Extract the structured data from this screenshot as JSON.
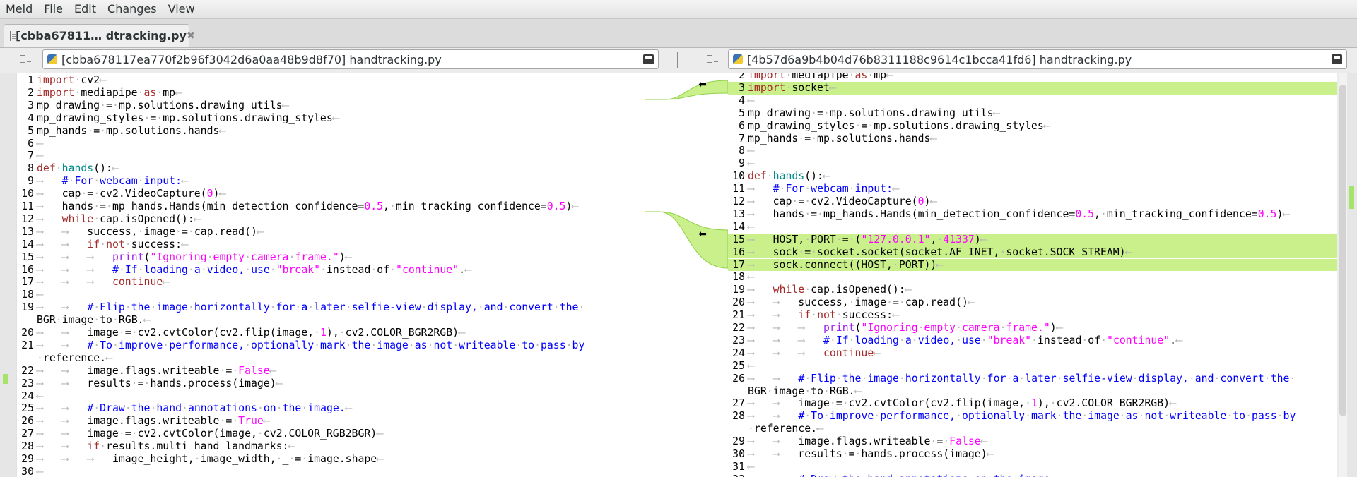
{
  "menu": [
    "Meld",
    "File",
    "Edit",
    "Changes",
    "View"
  ],
  "tab": {
    "label": "[cbba67811… dtracking.py",
    "close": "✖"
  },
  "left_file": {
    "path": "[cbba678117ea770f2b96f3042d6a0aa48b9d8f70] handtracking.py"
  },
  "right_file": {
    "path": "[4b57d6a9b4b04d76b8311188c9614c1bcca41fd6] handtracking.py"
  },
  "icons": {
    "doc": "document-icon",
    "python": "python-file-icon",
    "save": "save-icon",
    "options": "pane-options-icon",
    "arrow": "copy-left-arrow-icon",
    "close": "close-icon"
  },
  "colors": {
    "insert": "#c9f08a",
    "keyword": "#a52a2a",
    "string": "#ff00ff",
    "comment": "#0000ff"
  },
  "arrow_glyph": "⬅",
  "left_lines": [
    {
      "n": "1",
      "t": "import·cv2⟵"
    },
    {
      "n": "2",
      "t": "import·mediapipe·as·mp⟵"
    },
    {
      "n": "3",
      "t": "mp_drawing·=·mp.solutions.drawing_utils⟵"
    },
    {
      "n": "4",
      "t": "mp_drawing_styles·=·mp.solutions.drawing_styles⟵"
    },
    {
      "n": "5",
      "t": "mp_hands·=·mp.solutions.hands⟵"
    },
    {
      "n": "6",
      "t": "⟵"
    },
    {
      "n": "7",
      "t": "⟵"
    },
    {
      "n": "8",
      "t": "def·hands():⟵"
    },
    {
      "n": "9",
      "t": "⟶   #·For·webcam·input:⟵"
    },
    {
      "n": "10",
      "t": "⟶   cap·=·cv2.VideoCapture(0)⟵"
    },
    {
      "n": "11",
      "t": "⟶   hands·=·mp_hands.Hands(min_detection_confidence=0.5,·min_tracking_confidence=0.5)⟵"
    },
    {
      "n": "12",
      "t": "⟶   while·cap.isOpened():⟵"
    },
    {
      "n": "13",
      "t": "⟶   ⟶   success,·image·=·cap.read()⟵"
    },
    {
      "n": "14",
      "t": "⟶   ⟶   if·not·success:⟵"
    },
    {
      "n": "15",
      "t": "⟶   ⟶   ⟶   print(\"Ignoring·empty·camera·frame.\")⟵"
    },
    {
      "n": "16",
      "t": "⟶   ⟶   ⟶   #·If·loading·a·video,·use·\"break\"·instead·of·\"continue\".⟵"
    },
    {
      "n": "17",
      "t": "⟶   ⟶   ⟶   continue⟵"
    },
    {
      "n": "18",
      "t": "⟵"
    },
    {
      "n": "19",
      "t": "⟶   ⟶   #·Flip·the·image·horizontally·for·a·later·selfie-view·display,·and·convert·the·"
    },
    {
      "n": "",
      "t": "BGR·image·to·RGB.⟵"
    },
    {
      "n": "20",
      "t": "⟶   ⟶   image·=·cv2.cvtColor(cv2.flip(image,·1),·cv2.COLOR_BGR2RGB)⟵"
    },
    {
      "n": "21",
      "t": "⟶   ⟶   #·To·improve·performance,·optionally·mark·the·image·as·not·writeable·to·pass·by"
    },
    {
      "n": "",
      "t": "·reference.⟵"
    },
    {
      "n": "22",
      "t": "⟶   ⟶   image.flags.writeable·=·False⟵"
    },
    {
      "n": "23",
      "t": "⟶   ⟶   results·=·hands.process(image)⟵"
    },
    {
      "n": "24",
      "t": "⟵"
    },
    {
      "n": "25",
      "t": "⟶   ⟶   #·Draw·the·hand·annotations·on·the·image.⟵"
    },
    {
      "n": "26",
      "t": "⟶   ⟶   image.flags.writeable·=·True⟵"
    },
    {
      "n": "27",
      "t": "⟶   ⟶   image·=·cv2.cvtColor(image,·cv2.COLOR_RGB2BGR)⟵"
    },
    {
      "n": "28",
      "t": "⟶   ⟶   if·results.multi_hand_landmarks:⟵"
    },
    {
      "n": "29",
      "t": "⟶   ⟶   ⟶   image_height,·image_width,·_·=·image.shape⟵"
    },
    {
      "n": "30",
      "t": "⟵"
    }
  ],
  "right_lines": [
    {
      "n": "2",
      "t": "import·mediapipe·as·mp⟵"
    },
    {
      "n": "3",
      "t": "import·socket⟵"
    },
    {
      "n": "4",
      "t": "⟵"
    },
    {
      "n": "5",
      "t": "mp_drawing·=·mp.solutions.drawing_utils⟵"
    },
    {
      "n": "6",
      "t": "mp_drawing_styles·=·mp.solutions.drawing_styles⟵"
    },
    {
      "n": "7",
      "t": "mp_hands·=·mp.solutions.hands⟵"
    },
    {
      "n": "8",
      "t": "⟵"
    },
    {
      "n": "9",
      "t": "⟵"
    },
    {
      "n": "10",
      "t": "def·hands():⟵"
    },
    {
      "n": "11",
      "t": "⟶   #·For·webcam·input:⟵"
    },
    {
      "n": "12",
      "t": "⟶   cap·=·cv2.VideoCapture(0)⟵"
    },
    {
      "n": "13",
      "t": "⟶   hands·=·mp_hands.Hands(min_detection_confidence=0.5,·min_tracking_confidence=0.5)⟵"
    },
    {
      "n": "14",
      "t": "⟵"
    },
    {
      "n": "15",
      "t": "⟶   HOST,·PORT·=·(\"127.0.0.1\",·41337)⟵"
    },
    {
      "n": "16",
      "t": "⟶   sock·=·socket.socket(socket.AF_INET,·socket.SOCK_STREAM)⟵"
    },
    {
      "n": "17",
      "t": "⟶   sock.connect((HOST,·PORT))⟵"
    },
    {
      "n": "18",
      "t": "⟵"
    },
    {
      "n": "19",
      "t": "⟶   while·cap.isOpened():⟵"
    },
    {
      "n": "20",
      "t": "⟶   ⟶   success,·image·=·cap.read()⟵"
    },
    {
      "n": "21",
      "t": "⟶   ⟶   if·not·success:⟵"
    },
    {
      "n": "22",
      "t": "⟶   ⟶   ⟶   print(\"Ignoring·empty·camera·frame.\")⟵"
    },
    {
      "n": "23",
      "t": "⟶   ⟶   ⟶   #·If·loading·a·video,·use·\"break\"·instead·of·\"continue\".⟵"
    },
    {
      "n": "24",
      "t": "⟶   ⟶   ⟶   continue⟵"
    },
    {
      "n": "25",
      "t": "⟵"
    },
    {
      "n": "26",
      "t": "⟶   ⟶   #·Flip·the·image·horizontally·for·a·later·selfie-view·display,·and·convert·the·"
    },
    {
      "n": "",
      "t": "BGR·image·to·RGB.⟵"
    },
    {
      "n": "27",
      "t": "⟶   ⟶   image·=·cv2.cvtColor(cv2.flip(image,·1),·cv2.COLOR_BGR2RGB)⟵"
    },
    {
      "n": "28",
      "t": "⟶   ⟶   #·To·improve·performance,·optionally·mark·the·image·as·not·writeable·to·pass·by"
    },
    {
      "n": "",
      "t": "·reference.⟵"
    },
    {
      "n": "29",
      "t": "⟶   ⟶   image.flags.writeable·=·False⟵"
    },
    {
      "n": "30",
      "t": "⟶   ⟶   results·=·hands.process(image)⟵"
    },
    {
      "n": "31",
      "t": "⟵"
    },
    {
      "n": "32",
      "t": "⟶   ⟶   #·Draw·the·hand·annotations·on·the·image.⟵"
    }
  ]
}
